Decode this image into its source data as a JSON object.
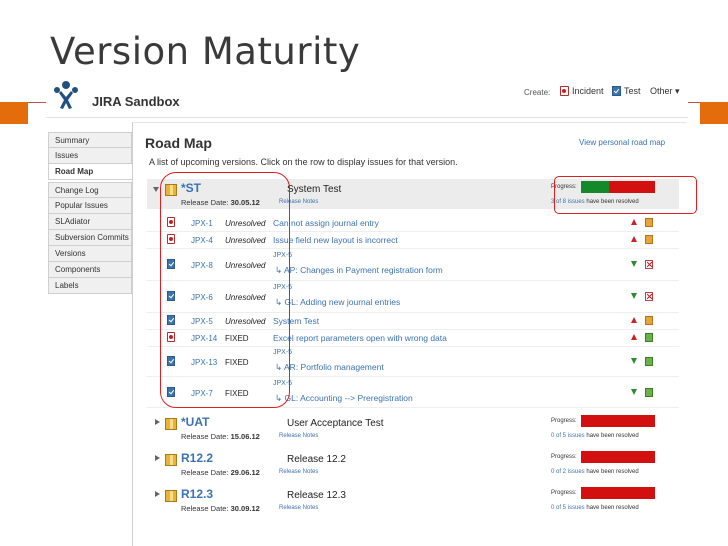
{
  "slide": {
    "title": "Version Maturity"
  },
  "app": {
    "title": "JIRA Sandbox"
  },
  "create_bar": {
    "label": "Create:",
    "incident": "Incident",
    "test": "Test",
    "other": "Other ▾"
  },
  "sidebar": {
    "items": [
      {
        "label": "Summary"
      },
      {
        "label": "Issues"
      },
      {
        "label": "Road Map"
      },
      {
        "label": "Change Log"
      },
      {
        "label": "Popular Issues"
      },
      {
        "label": "SLAdiator"
      },
      {
        "label": "Subversion Commits"
      },
      {
        "label": "Versions"
      },
      {
        "label": "Components"
      },
      {
        "label": "Labels"
      }
    ]
  },
  "roadmap": {
    "title": "Road Map",
    "personal_link": "View personal road map",
    "description": "A list of upcoming versions. Click on the row to display issues for that version.",
    "release_date_label": "Release Date:",
    "release_notes_label": "Release Notes",
    "progress_label": "Progress:",
    "versions": [
      {
        "name": "*ST",
        "description": "System Test",
        "release_date": "30.05.12",
        "progress": {
          "resolved": 3,
          "total": 8,
          "link_text": "3 of 8 issues",
          "suffix": "have been resolved"
        },
        "issues": [
          {
            "key": "JPX-1",
            "status": "Unresolved",
            "summary": "Can not assign journal entry",
            "type": "bug",
            "priority": "up",
            "state": "open"
          },
          {
            "key": "JPX-4",
            "status": "Unresolved",
            "summary": "Issue field new layout is incorrect",
            "type": "bug",
            "priority": "up",
            "state": "open"
          },
          {
            "key": "JPX-8",
            "status": "Unresolved",
            "parent": "JPX-5",
            "summary": "AP: Changes in Payment registration form",
            "type": "task",
            "priority": "down",
            "state": "rejected"
          },
          {
            "key": "JPX-6",
            "status": "Unresolved",
            "parent": "JPX-5",
            "summary": "GL: Adding new journal entries",
            "type": "task",
            "priority": "down",
            "state": "rejected"
          },
          {
            "key": "JPX-5",
            "status": "Unresolved",
            "summary": "System Test",
            "type": "task",
            "priority": "up",
            "state": "open"
          },
          {
            "key": "JPX-14",
            "status": "FIXED",
            "summary": "Excel report parameters open with wrong data",
            "type": "bug",
            "priority": "up",
            "state": "closed"
          },
          {
            "key": "JPX-13",
            "status": "FIXED",
            "parent": "JPX-5",
            "summary": "AR: Portfolio management",
            "type": "task",
            "priority": "down",
            "state": "closed"
          },
          {
            "key": "JPX-7",
            "status": "FIXED",
            "parent": "JPX-5",
            "summary": "GL: Accounting --> Preregistration",
            "type": "task",
            "priority": "down",
            "state": "closed"
          }
        ]
      },
      {
        "name": "*UAT",
        "description": "User Acceptance Test",
        "release_date": "15.06.12",
        "progress": {
          "resolved": 0,
          "total": 5,
          "link_text": "0 of 5 issues",
          "suffix": "have been resolved"
        }
      },
      {
        "name": "R12.2",
        "description": "Release 12.2",
        "release_date": "29.06.12",
        "progress": {
          "resolved": 0,
          "total": 2,
          "link_text": "0 of 2 issues",
          "suffix": "have been resolved"
        }
      },
      {
        "name": "R12.3",
        "description": "Release 12.3",
        "release_date": "30.09.12",
        "progress": {
          "resolved": 0,
          "total": 5,
          "link_text": "0 of 5 issues",
          "suffix": "have been resolved"
        }
      }
    ]
  },
  "colors": {
    "accent_link": "#3b73af",
    "progress_resolved": "#14892c",
    "progress_unresolved": "#d21010",
    "annotation": "#e02020",
    "slide_accent": "#e46c0a"
  }
}
